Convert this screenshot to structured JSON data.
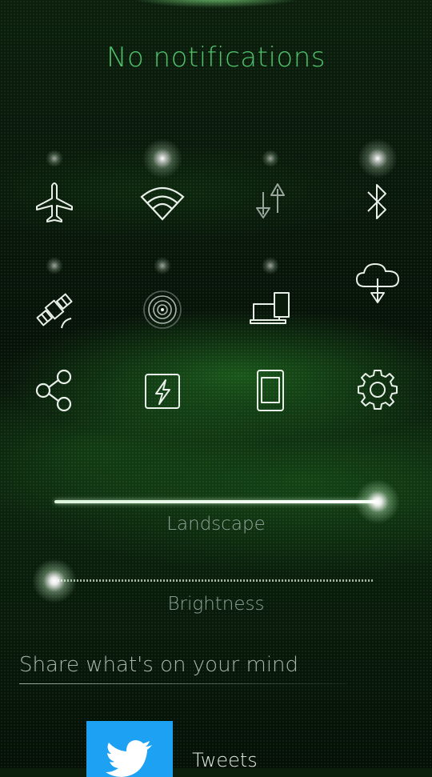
{
  "header": {
    "title": "No notifications"
  },
  "toggles": [
    {
      "id": "flight-mode",
      "icon": "airplane-icon",
      "enabled": false
    },
    {
      "id": "wlan",
      "icon": "wifi-icon",
      "enabled": true
    },
    {
      "id": "mobile-data",
      "icon": "mobile-data-arrows-icon",
      "enabled": false
    },
    {
      "id": "bluetooth",
      "icon": "bluetooth-icon",
      "enabled": true
    },
    {
      "id": "location",
      "icon": "satellite-icon",
      "enabled": false
    },
    {
      "id": "nfc",
      "icon": "nfc-rings-icon",
      "enabled": false
    },
    {
      "id": "sync",
      "icon": "devices-icon",
      "enabled": false
    },
    {
      "id": "cloud-download",
      "icon": "cloud-download-icon",
      "enabled": false
    },
    {
      "id": "share",
      "icon": "share-icon"
    },
    {
      "id": "power-save",
      "icon": "battery-flash-icon"
    },
    {
      "id": "orientation",
      "icon": "phone-portrait-icon"
    },
    {
      "id": "settings",
      "icon": "settings-gear-icon"
    }
  ],
  "sliders": {
    "orientation": {
      "label": "Landscape",
      "value": 1.0
    },
    "brightness": {
      "label": "Brightness",
      "value": 0.0
    }
  },
  "share": {
    "placeholder": "Share what's on your mind"
  },
  "feeds": [
    {
      "label": "Tweets",
      "icon": "twitter-bird-icon",
      "color": "#1da1f2"
    }
  ],
  "colors": {
    "accent": "#4fbf6a",
    "label": "#8fa59a"
  }
}
